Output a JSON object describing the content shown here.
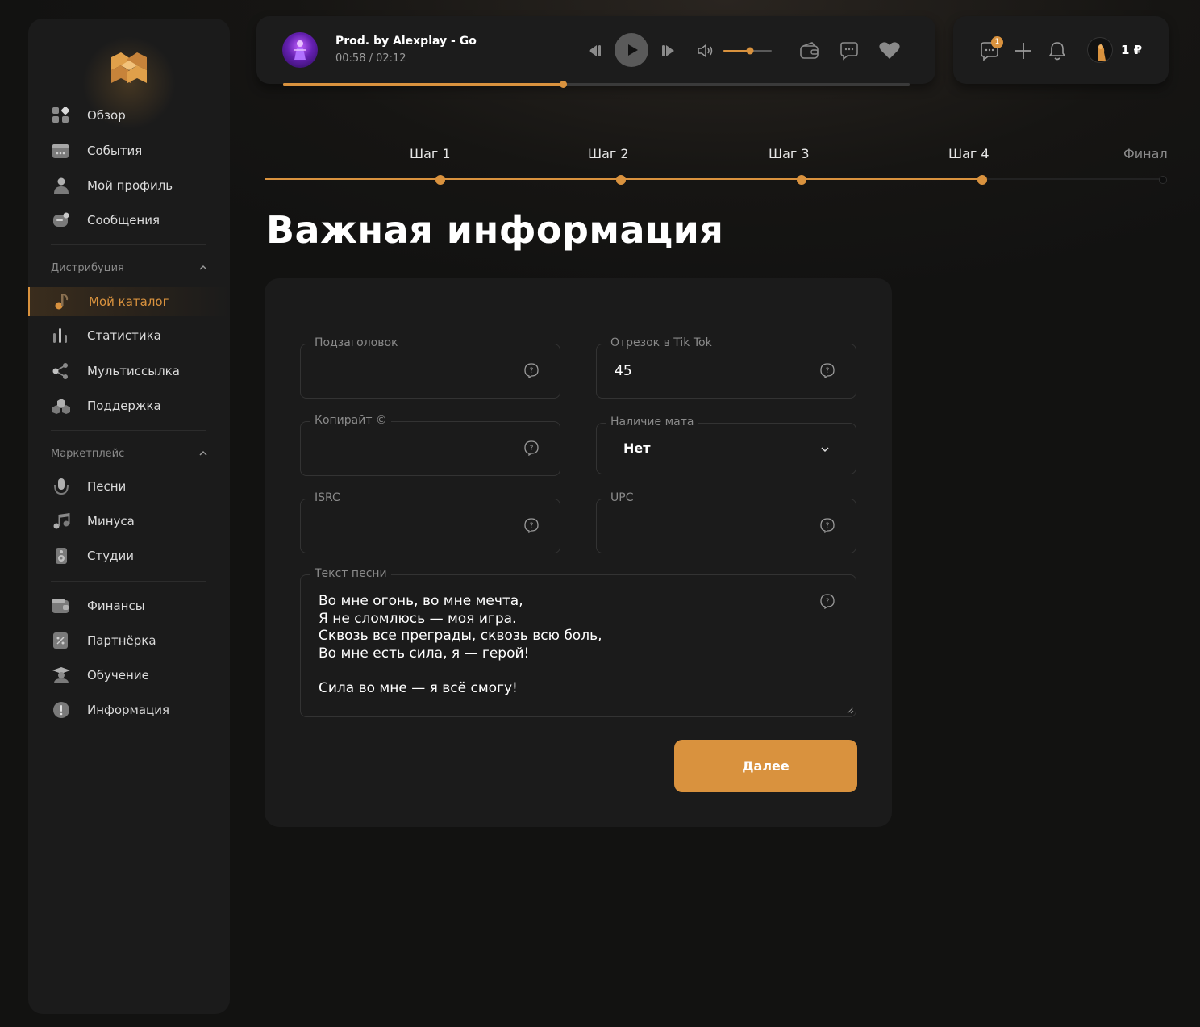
{
  "sidebar": {
    "main_items": [
      {
        "label": "Обзор",
        "icon": "grid-icon"
      },
      {
        "label": "События",
        "icon": "calendar-icon"
      },
      {
        "label": "Мой профиль",
        "icon": "user-icon"
      },
      {
        "label": "Сообщения",
        "icon": "message-icon"
      }
    ],
    "distribution": {
      "title": "Дистрибуция",
      "items": [
        {
          "label": "Мой каталог",
          "icon": "music-note-icon",
          "active": true
        },
        {
          "label": "Статистика",
          "icon": "bars-icon"
        },
        {
          "label": "Мультиссылка",
          "icon": "share-icon"
        },
        {
          "label": "Поддержка",
          "icon": "support-icon"
        }
      ]
    },
    "marketplace": {
      "title": "Маркетплейс",
      "items": [
        {
          "label": "Песни",
          "icon": "microphone-icon"
        },
        {
          "label": "Минуса",
          "icon": "music-icon"
        },
        {
          "label": "Студии",
          "icon": "speaker-icon"
        }
      ]
    },
    "bottom_items": [
      {
        "label": "Финансы",
        "icon": "wallet-icon"
      },
      {
        "label": "Партнёрка",
        "icon": "percent-icon"
      },
      {
        "label": "Обучение",
        "icon": "graduation-icon"
      },
      {
        "label": "Информация",
        "icon": "info-icon"
      }
    ]
  },
  "player": {
    "track_title": "Prod. by Alexplay - Go",
    "time": "00:58 / 02:12",
    "progress": 0.446,
    "volume": 0.55
  },
  "topbar": {
    "chat_badge": "1",
    "balance": "1 ₽"
  },
  "stepper": {
    "steps": [
      "Шаг 1",
      "Шаг 2",
      "Шаг 3",
      "Шаг 4",
      "Финал"
    ],
    "current_step": 4
  },
  "page": {
    "title": "Важная информация"
  },
  "form": {
    "subtitle": {
      "label": "Подзаголовок",
      "value": ""
    },
    "tiktok": {
      "label": "Отрезок в Tik Tok",
      "value": "45"
    },
    "copyright": {
      "label": "Копирайт ©",
      "value": ""
    },
    "explicit": {
      "label": "Наличие мата",
      "value": "Нет"
    },
    "isrc": {
      "label": "ISRC",
      "value": ""
    },
    "upc": {
      "label": "UPC",
      "value": ""
    },
    "lyrics": {
      "label": "Текст песни",
      "value": "Во мне огонь, во мне мечта,\nЯ не сломлюсь — моя игра.\nСквозь все преграды, сквозь всю боль,\nВо мне есть сила, я — герой!\n\nСила во мне — я всё смогу!"
    },
    "next_label": "Далее"
  },
  "colors": {
    "accent": "#d9923e",
    "card": "#1b1b1b",
    "background": "#141414"
  }
}
